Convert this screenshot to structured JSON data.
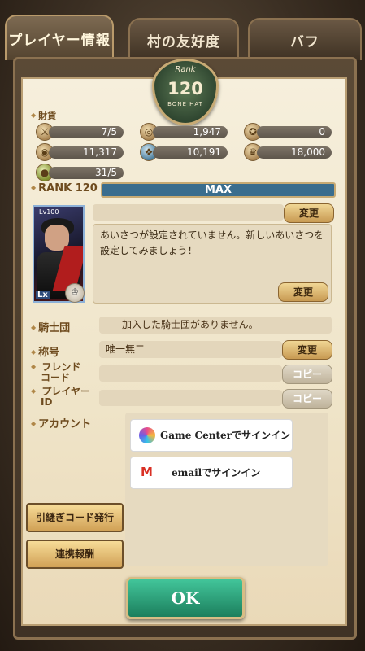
{
  "tabs": [
    "プレイヤー情報",
    "村の友好度",
    "バフ"
  ],
  "emblem": {
    "rank_label": "Rank",
    "rank": "120",
    "tag": "BONE HAT"
  },
  "assets_label": "財貨",
  "resources": [
    {
      "icon": "sword-icon",
      "value": "7/5"
    },
    {
      "icon": "silver-coin-icon",
      "value": "1,947"
    },
    {
      "icon": "medal-icon",
      "value": "0"
    },
    {
      "icon": "gold-coin-icon",
      "value": "11,317"
    },
    {
      "icon": "blue-gem-icon",
      "value": "10,191"
    },
    {
      "icon": "trophy-medal-icon",
      "value": "18,000"
    },
    {
      "icon": "green-orb-icon",
      "value": "31/5"
    }
  ],
  "rank": {
    "label": "RANK 120",
    "bar_text": "MAX"
  },
  "portrait": {
    "level": "Lv100",
    "badge": "Lx"
  },
  "greeting": {
    "text": "あいさつが設定されていません。新しいあいさつを設定してみましょう！"
  },
  "buttons": {
    "change": "変更",
    "copy": "コピー"
  },
  "knights": {
    "label": "騎士団",
    "value": "加入した騎士団がありません。"
  },
  "title_row": {
    "label": "称号",
    "value": "唯一無二"
  },
  "friend_code": {
    "label_line1": "フレンド",
    "label_line2": "コード"
  },
  "player_id": {
    "label_line1": "プレイヤー",
    "label_line2": "ID"
  },
  "account": {
    "label": "アカウント",
    "game_center": "Game Centerでサインイン",
    "email": "emailでサインイン"
  },
  "side_buttons": {
    "transfer": "引継ぎコード発行",
    "link_reward": "連携報酬"
  },
  "ok": "OK"
}
